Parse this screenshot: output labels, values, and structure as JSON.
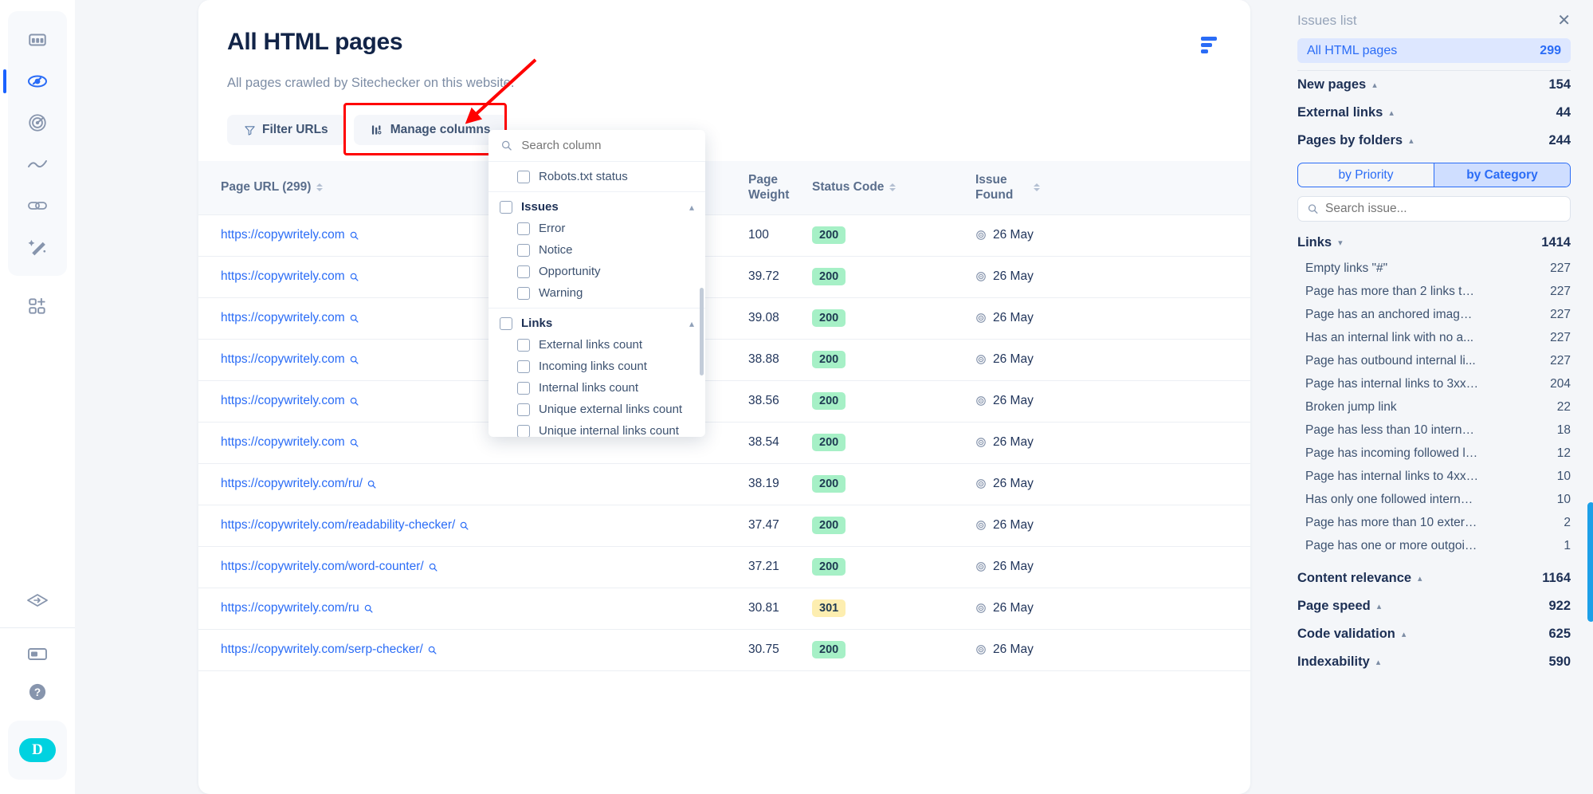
{
  "left_rail": {
    "items": [
      {
        "name": "dashboard-icon",
        "label": "Dashboard",
        "active": false
      },
      {
        "name": "site-audit-icon",
        "label": "Site Audit",
        "active": true
      },
      {
        "name": "monitoring-icon",
        "label": "Monitoring",
        "active": false
      },
      {
        "name": "rank-tracker-icon",
        "label": "Rank Tracker",
        "active": false
      },
      {
        "name": "backlinks-icon",
        "label": "Backlinks",
        "active": false
      },
      {
        "name": "tools-icon",
        "label": "Tools",
        "active": false
      }
    ],
    "apps_item": {
      "name": "add-apps-icon",
      "label": "Apps"
    },
    "bottom_items": [
      {
        "name": "switch-project-icon",
        "label": "Switch project"
      },
      {
        "name": "billing-icon",
        "label": "Billing"
      },
      {
        "name": "help-icon",
        "label": "Help"
      }
    ],
    "avatar_initial": "D"
  },
  "header": {
    "title": "All HTML pages",
    "subtitle": "All pages crawled by Sitechecker on this website.",
    "sort_icon": "sort-lines-icon"
  },
  "toolbar": {
    "filter_label": "Filter URLs",
    "filter_icon": "funnel-icon",
    "manage_columns_label": "Manage columns",
    "manage_columns_icon": "columns-icon"
  },
  "columns_dropdown": {
    "search_placeholder": "Search column",
    "search_icon": "search-icon",
    "sections": [
      {
        "group": null,
        "rows": [
          {
            "label": "Robots.txt status",
            "level": 1,
            "checked": false
          }
        ]
      },
      {
        "group": {
          "label": "Issues",
          "level": 0,
          "checked": false,
          "chevron": "chevron-up-icon"
        },
        "rows": [
          {
            "label": "Error",
            "level": 1,
            "checked": false
          },
          {
            "label": "Notice",
            "level": 1,
            "checked": false
          },
          {
            "label": "Opportunity",
            "level": 1,
            "checked": false
          },
          {
            "label": "Warning",
            "level": 1,
            "checked": false
          }
        ]
      },
      {
        "group": {
          "label": "Links",
          "level": 0,
          "checked": false,
          "chevron": "chevron-up-icon"
        },
        "rows": [
          {
            "label": "External links count",
            "level": 1,
            "checked": false
          },
          {
            "label": "Incoming links count",
            "level": 1,
            "checked": false
          },
          {
            "label": "Internal links count",
            "level": 1,
            "checked": false
          },
          {
            "label": "Unique external links count",
            "level": 1,
            "checked": false
          },
          {
            "label": "Unique internal links count",
            "level": 1,
            "checked": false
          }
        ]
      }
    ]
  },
  "table": {
    "columns": [
      {
        "key": "url",
        "label": "Page URL (299)",
        "sortable": true
      },
      {
        "key": "weight",
        "label": "Page Weight",
        "sortable": false
      },
      {
        "key": "status",
        "label": "Status Code",
        "sortable": true
      },
      {
        "key": "issue",
        "label": "Issue Found",
        "sortable": true
      }
    ],
    "rows": [
      {
        "url": "https://copywritely.com",
        "weight": "100",
        "status": "200",
        "status_kind": "ok",
        "issue": "26 May"
      },
      {
        "url": "https://copywritely.com",
        "weight": "39.72",
        "status": "200",
        "status_kind": "ok",
        "issue": "26 May"
      },
      {
        "url": "https://copywritely.com",
        "weight": "39.08",
        "status": "200",
        "status_kind": "ok",
        "issue": "26 May"
      },
      {
        "url": "https://copywritely.com",
        "weight": "38.88",
        "status": "200",
        "status_kind": "ok",
        "issue": "26 May"
      },
      {
        "url": "https://copywritely.com",
        "weight": "38.56",
        "status": "200",
        "status_kind": "ok",
        "issue": "26 May"
      },
      {
        "url": "https://copywritely.com",
        "weight": "38.54",
        "status": "200",
        "status_kind": "ok",
        "issue": "26 May"
      },
      {
        "url": "https://copywritely.com/ru/",
        "weight": "38.19",
        "status": "200",
        "status_kind": "ok",
        "issue": "26 May"
      },
      {
        "url": "https://copywritely.com/readability-checker/",
        "weight": "37.47",
        "status": "200",
        "status_kind": "ok",
        "issue": "26 May"
      },
      {
        "url": "https://copywritely.com/word-counter/",
        "weight": "37.21",
        "status": "200",
        "status_kind": "ok",
        "issue": "26 May"
      },
      {
        "url": "https://copywritely.com/ru",
        "weight": "30.81",
        "status": "301",
        "status_kind": "warn",
        "issue": "26 May"
      },
      {
        "url": "https://copywritely.com/serp-checker/",
        "weight": "30.75",
        "status": "200",
        "status_kind": "ok",
        "issue": "26 May"
      }
    ]
  },
  "issues_panel": {
    "title": "Issues list",
    "close_icon": "close-icon",
    "all_pages": {
      "label": "All HTML pages",
      "count": "299"
    },
    "groups_top": [
      {
        "label": "New pages",
        "count": "154",
        "chevron": "chevron-up-icon"
      },
      {
        "label": "External links",
        "count": "44",
        "chevron": "chevron-up-icon"
      },
      {
        "label": "Pages by folders",
        "count": "244",
        "chevron": "chevron-up-icon"
      }
    ],
    "toggle": {
      "left": "by Priority",
      "right": "by Category",
      "selected": "by Category"
    },
    "search_placeholder": "Search issue...",
    "search_icon": "search-icon",
    "links_group": {
      "label": "Links",
      "count": "1414",
      "chevron": "chevron-down-icon"
    },
    "links_items": [
      {
        "label": "Empty links \"#\"",
        "count": "227"
      },
      {
        "label": "Page has more than 2 links to ...",
        "count": "227"
      },
      {
        "label": "Page has an anchored image ...",
        "count": "227"
      },
      {
        "label": "Has an internal link with no a...",
        "count": "227"
      },
      {
        "label": "Page has outbound internal li...",
        "count": "227"
      },
      {
        "label": "Page has internal links to 3xx ...",
        "count": "204"
      },
      {
        "label": "Broken jump link",
        "count": "22"
      },
      {
        "label": "Page has less than 10 internal b...",
        "count": "18"
      },
      {
        "label": "Page has incoming followed lin...",
        "count": "12"
      },
      {
        "label": "Page has internal links to 4xx p...",
        "count": "10"
      },
      {
        "label": "Has only one followed internal l...",
        "count": "10"
      },
      {
        "label": "Page has more than 10 external l...",
        "count": "2"
      },
      {
        "label": "Page has one or more outgoing f...",
        "count": "1"
      }
    ],
    "groups_bottom": [
      {
        "label": "Content relevance",
        "count": "1164",
        "chevron": "chevron-up-icon"
      },
      {
        "label": "Page speed",
        "count": "922",
        "chevron": "chevron-up-icon"
      },
      {
        "label": "Code validation",
        "count": "625",
        "chevron": "chevron-up-icon"
      },
      {
        "label": "Indexability",
        "count": "590",
        "chevron": "chevron-up-icon"
      }
    ]
  },
  "annotation": {
    "highlight_color": "#ff0000",
    "arrow_color": "#ff0000"
  }
}
